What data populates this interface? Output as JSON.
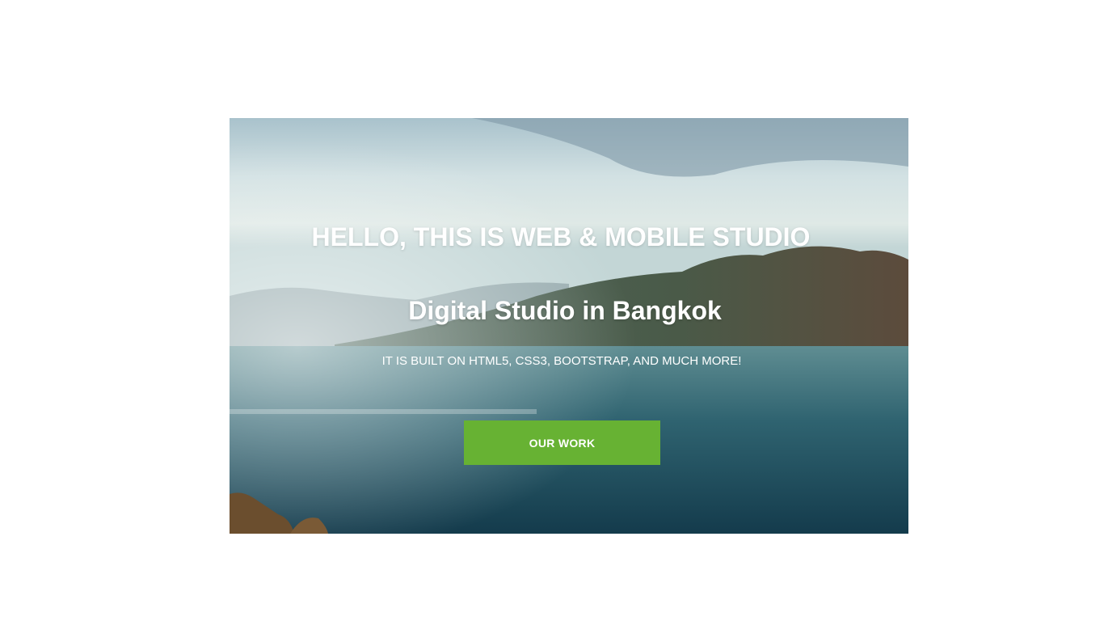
{
  "hero": {
    "headline": "HELLO, THIS IS WEB & MOBILE STUDIO",
    "subheadline": "Digital Studio in Bangkok",
    "tagline": "IT IS BUILT ON HTML5, CSS3, BOOTSTRAP, AND MUCH MORE!",
    "cta_label": "OUR WORK",
    "background_image": "lake-and-mountains-landscape"
  },
  "colors": {
    "cta_background": "#67b233",
    "text": "#ffffff",
    "page_background": "#ffffff"
  }
}
